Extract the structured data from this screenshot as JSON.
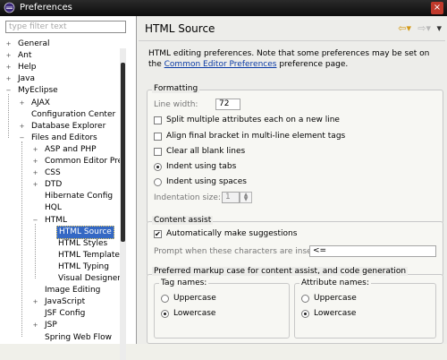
{
  "window": {
    "title": "Preferences",
    "close_glyph": "×"
  },
  "filter": {
    "placeholder": "type filter text"
  },
  "tree": [
    {
      "label": "General",
      "depth": 0,
      "expander": "+"
    },
    {
      "label": "Ant",
      "depth": 0,
      "expander": "+"
    },
    {
      "label": "Help",
      "depth": 0,
      "expander": "+"
    },
    {
      "label": "Java",
      "depth": 0,
      "expander": "+"
    },
    {
      "label": "MyEclipse",
      "depth": 0,
      "expander": "−"
    },
    {
      "label": "AJAX",
      "depth": 1,
      "expander": "+"
    },
    {
      "label": "Configuration Center",
      "depth": 1,
      "expander": ""
    },
    {
      "label": "Database Explorer",
      "depth": 1,
      "expander": "+"
    },
    {
      "label": "Files and Editors",
      "depth": 1,
      "expander": "−"
    },
    {
      "label": "ASP and PHP",
      "depth": 2,
      "expander": "+"
    },
    {
      "label": "Common Editor Pre",
      "depth": 2,
      "expander": "+"
    },
    {
      "label": "CSS",
      "depth": 2,
      "expander": "+"
    },
    {
      "label": "DTD",
      "depth": 2,
      "expander": "+"
    },
    {
      "label": "Hibernate Config",
      "depth": 2,
      "expander": ""
    },
    {
      "label": "HQL",
      "depth": 2,
      "expander": ""
    },
    {
      "label": "HTML",
      "depth": 2,
      "expander": "−"
    },
    {
      "label": "HTML Source",
      "depth": 3,
      "expander": "",
      "selected": true
    },
    {
      "label": "HTML Styles",
      "depth": 3,
      "expander": ""
    },
    {
      "label": "HTML Template",
      "depth": 3,
      "expander": ""
    },
    {
      "label": "HTML Typing",
      "depth": 3,
      "expander": ""
    },
    {
      "label": "Visual Designer",
      "depth": 3,
      "expander": ""
    },
    {
      "label": "Image Editing",
      "depth": 2,
      "expander": ""
    },
    {
      "label": "JavaScript",
      "depth": 2,
      "expander": "+"
    },
    {
      "label": "JSF Config",
      "depth": 2,
      "expander": ""
    },
    {
      "label": "JSP",
      "depth": 2,
      "expander": "+"
    },
    {
      "label": "Spring Web Flow",
      "depth": 2,
      "expander": ""
    }
  ],
  "page": {
    "title": "HTML Source",
    "toolbar": {
      "back_glyph": "⇦▾",
      "forward_glyph": "⇨▾",
      "menu_glyph": "▾"
    },
    "description_prefix": "HTML editing preferences.  Note that some preferences may be set on the ",
    "description_link": "Common Editor Preferences",
    "description_suffix": " preference page."
  },
  "formatting": {
    "label": "Formatting",
    "line_width_label": "Line width:",
    "line_width_value": "72",
    "split_attrs": "Split multiple attributes each on a new line",
    "align_bracket": "Align final bracket in multi-line element tags",
    "clear_blank": "Clear all blank lines",
    "indent_tabs": "Indent using tabs",
    "indent_spaces": "Indent using spaces",
    "indent_size_label": "Indentation size:",
    "indent_size_value": "1"
  },
  "content_assist": {
    "label": "Content assist",
    "auto_suggest": "Automatically make suggestions",
    "prompt_label": "Prompt when these characters are inserted:",
    "prompt_value": "<="
  },
  "markup_case": {
    "label": "Preferred markup case for content assist, and code generation",
    "tag_label": "Tag names:",
    "attr_label": "Attribute names:",
    "upper": "Uppercase",
    "lower": "Lowercase"
  },
  "colors": {
    "selection": "#3468c4",
    "link": "#0a3aa5",
    "titlebar": "#111111"
  },
  "icons": {
    "app": "eclipse-icon",
    "close": "close-icon",
    "back": "back-arrow-icon",
    "forward": "forward-arrow-icon",
    "menu": "view-menu-icon"
  }
}
